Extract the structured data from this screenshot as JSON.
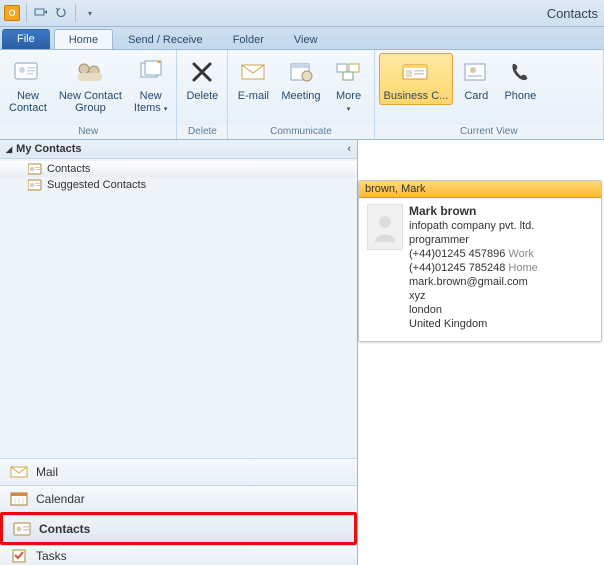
{
  "titlebar": {
    "app": "O",
    "title": "Contacts"
  },
  "tabs": {
    "file": "File",
    "home": "Home",
    "send_receive": "Send / Receive",
    "folder": "Folder",
    "view": "View"
  },
  "ribbon": {
    "groups": {
      "new": "New",
      "delete": "Delete",
      "communicate": "Communicate",
      "current_view": "Current View"
    },
    "new_contact": "New\nContact",
    "new_contact_group": "New Contact\nGroup",
    "new_items": "New\nItems",
    "delete": "Delete",
    "email": "E-mail",
    "meeting": "Meeting",
    "more": "More",
    "business_card": "Business C...",
    "card": "Card",
    "phone": "Phone"
  },
  "sidebar": {
    "header": "My Contacts",
    "items": [
      {
        "label": "Contacts"
      },
      {
        "label": "Suggested Contacts"
      }
    ],
    "nav": {
      "mail": "Mail",
      "calendar": "Calendar",
      "contacts": "Contacts",
      "tasks": "Tasks"
    }
  },
  "card": {
    "head": "brown, Mark",
    "name": "Mark brown",
    "company": "infopath company pvt. ltd.",
    "title": "programmer",
    "phone1": "(+44)01245 457896",
    "phone1_label": "Work",
    "phone2": "(+44)01245 785248",
    "phone2_label": "Home",
    "email": "mark.brown@gmail.com",
    "line1": "xyz",
    "line2": "london",
    "line3": "United Kingdom"
  }
}
